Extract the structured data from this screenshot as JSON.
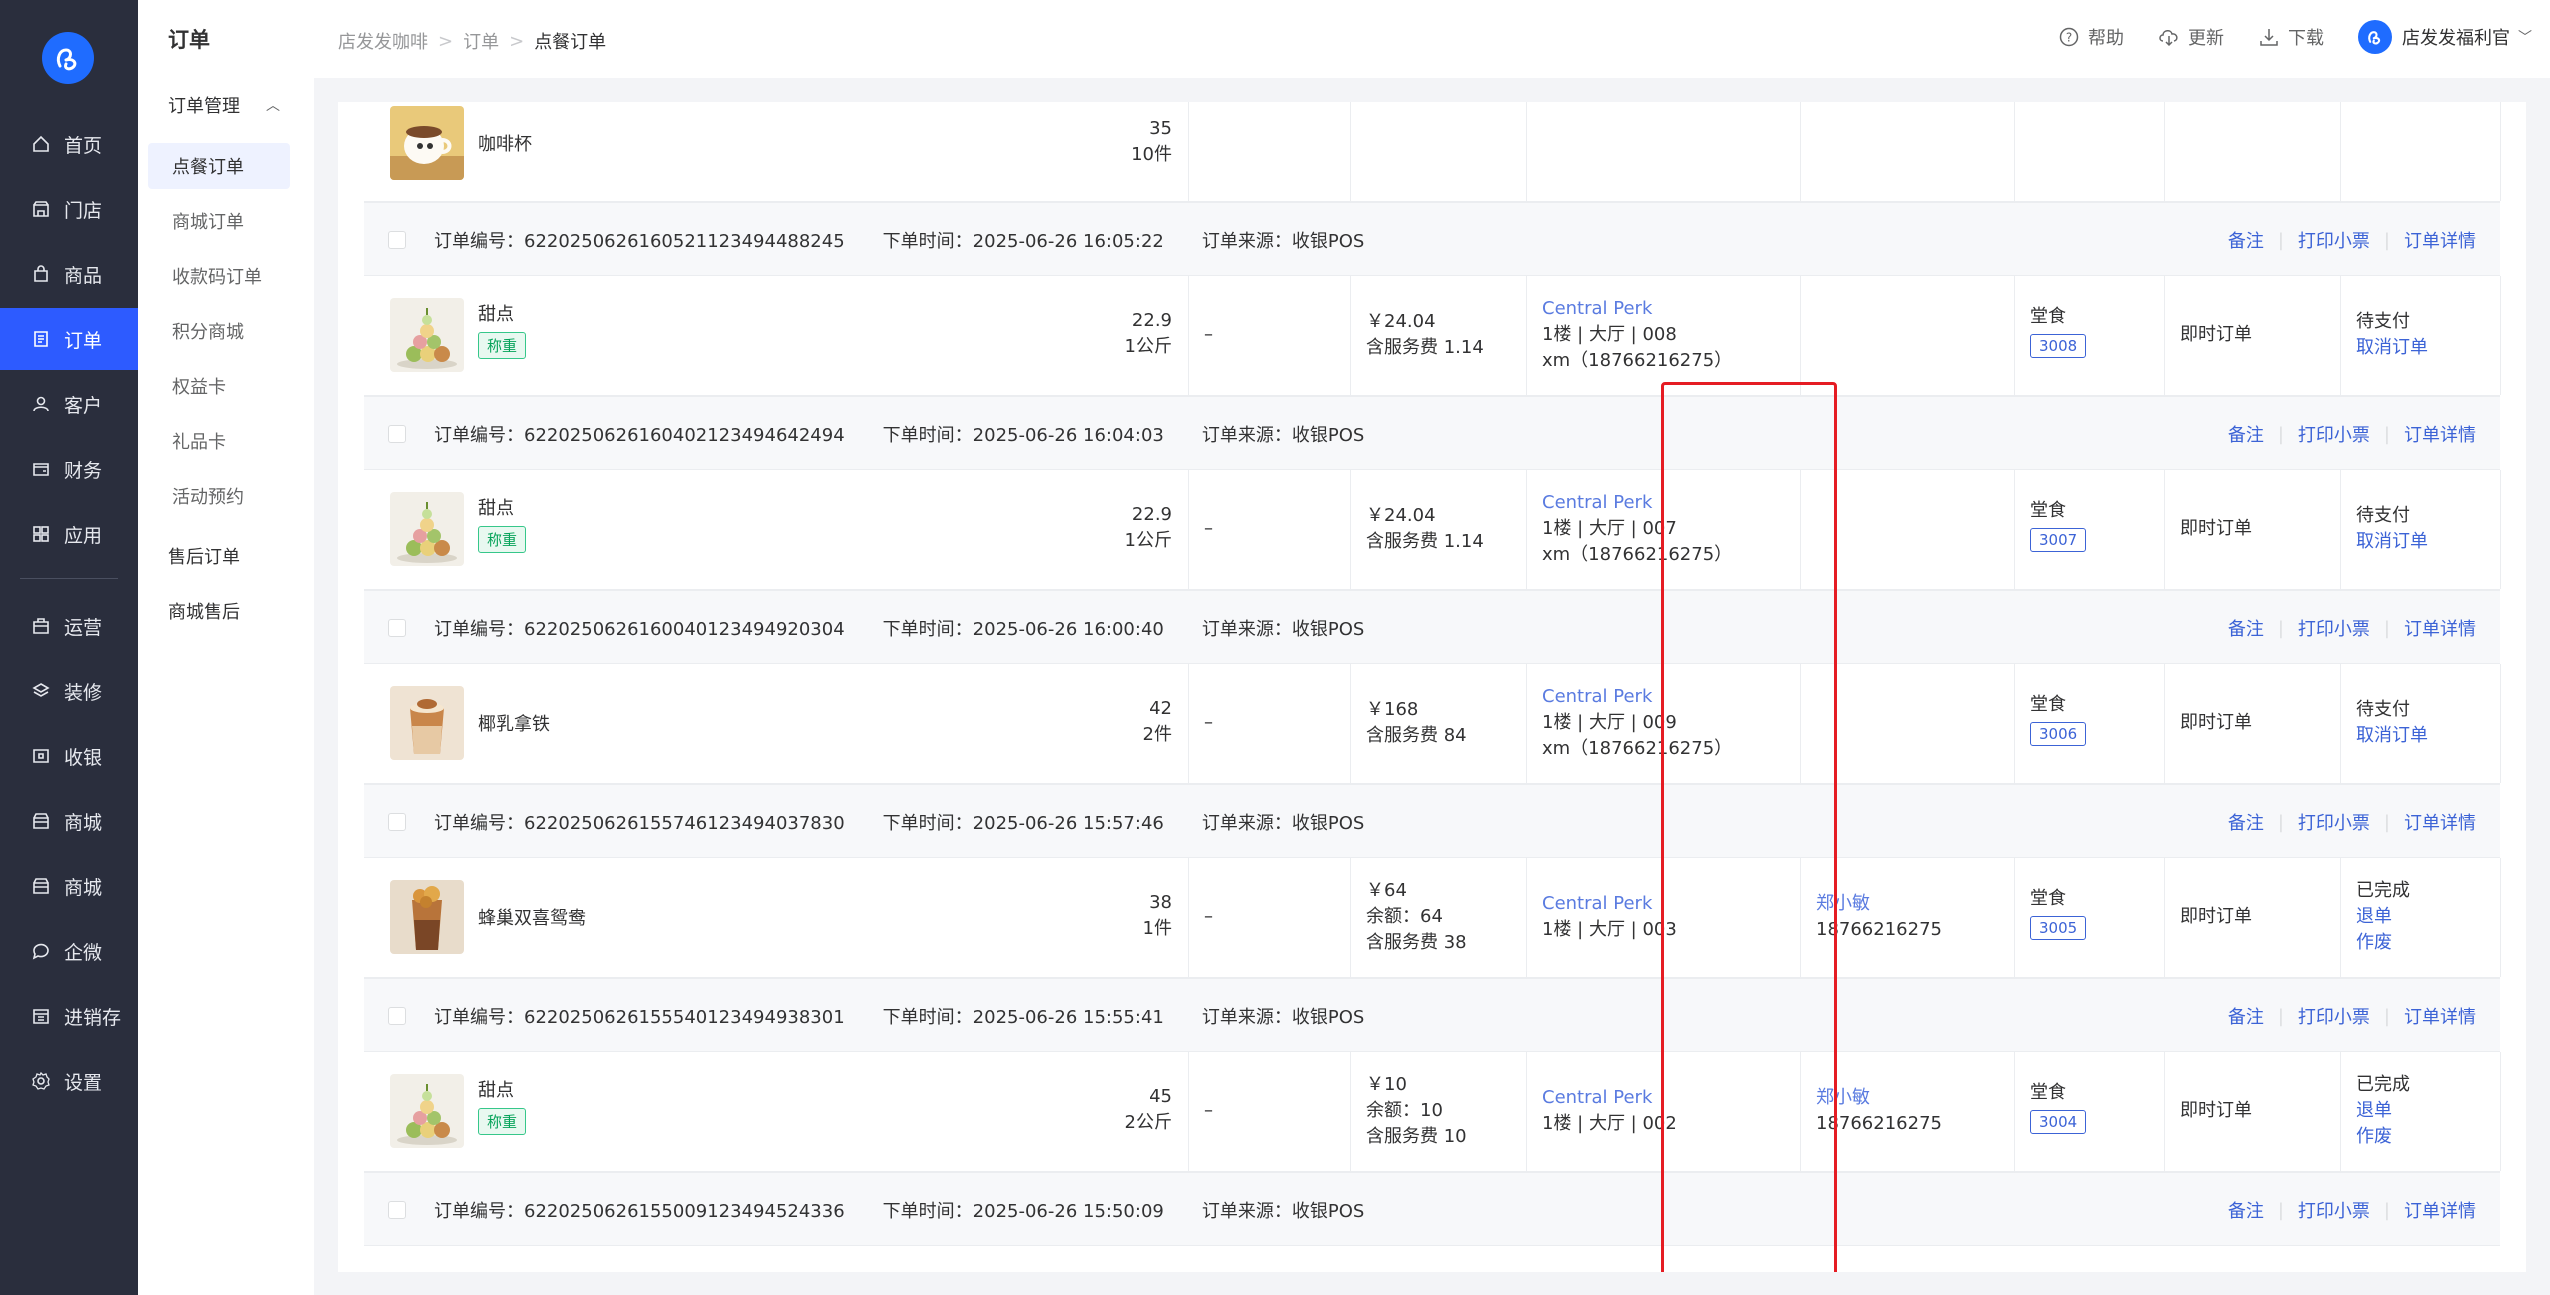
{
  "nav": {
    "items": [
      {
        "label": "首页",
        "icon": "home-icon"
      },
      {
        "label": "门店",
        "icon": "store-icon"
      },
      {
        "label": "商品",
        "icon": "bag-icon"
      },
      {
        "label": "订单",
        "icon": "order-icon",
        "active": true
      },
      {
        "label": "客户",
        "icon": "user-icon"
      },
      {
        "label": "财务",
        "icon": "wallet-icon"
      },
      {
        "label": "应用",
        "icon": "apps-icon"
      },
      {
        "label": "运营",
        "icon": "operation-icon"
      },
      {
        "label": "装修",
        "icon": "layers-icon"
      },
      {
        "label": "收银",
        "icon": "cashier-icon"
      },
      {
        "label": "商城",
        "icon": "shop-icon"
      },
      {
        "label": "商城",
        "icon": "shop-icon"
      },
      {
        "label": "企微",
        "icon": "chat-icon"
      },
      {
        "label": "进销存",
        "icon": "inventory-icon"
      },
      {
        "label": "设置",
        "icon": "settings-icon"
      }
    ]
  },
  "subnav": {
    "title": "订单",
    "group": "订单管理",
    "items": [
      "点餐订单",
      "商城订单",
      "收款码订单",
      "积分商城",
      "权益卡",
      "礼品卡",
      "活动预约"
    ],
    "extra": [
      "售后订单",
      "商城售后"
    ]
  },
  "header": {
    "breadcrumb": [
      "店发发咖啡",
      "订单",
      "点餐订单"
    ],
    "help": "帮助",
    "update": "更新",
    "download": "下载",
    "user": "店发发福利官"
  },
  "orders": {
    "top_product": {
      "name": "咖啡杯",
      "price": "35",
      "qty": "10件"
    },
    "ops": {
      "note": "备注",
      "print": "打印小票",
      "detail": "订单详情"
    },
    "labels": {
      "no": "订单编号：",
      "time": "下单时间：",
      "source": "订单来源："
    },
    "list": [
      {
        "no": "622025062616052112349448824 5",
        "no_full": "6220250626160521123494488245",
        "time": "2025-06-26 16:05:22",
        "source": "收银POS",
        "product": "甜点",
        "tag": "称重",
        "price": "22.9",
        "qty": "1公斤",
        "discount": "–",
        "amount": [
          "￥24.04",
          "含服务费 1.14"
        ],
        "store": "Central Perk",
        "store_info": "1楼 | 大厅 |  008",
        "customer_line": "xm（18766216275）",
        "buyer_name": "",
        "buyer_phone": "",
        "dine": "堂食",
        "pickup": "3008",
        "type": "即时订单",
        "status": "待支付",
        "actions": [
          "取消订单"
        ]
      },
      {
        "no_full": "6220250626160402123494642494",
        "time": "2025-06-26 16:04:03",
        "source": "收银POS",
        "product": "甜点",
        "tag": "称重",
        "price": "22.9",
        "qty": "1公斤",
        "discount": "–",
        "amount": [
          "￥24.04",
          "含服务费 1.14"
        ],
        "store": "Central Perk",
        "store_info": "1楼 | 大厅 |  007",
        "customer_line": "xm（18766216275）",
        "buyer_name": "",
        "buyer_phone": "",
        "dine": "堂食",
        "pickup": "3007",
        "type": "即时订单",
        "status": "待支付",
        "actions": [
          "取消订单"
        ]
      },
      {
        "no_full": "6220250626160040123494920304",
        "time": "2025-06-26 16:00:40",
        "source": "收银POS",
        "product": "椰乳拿铁",
        "tag": "",
        "price": "42",
        "qty": "2件",
        "discount": "–",
        "amount": [
          "￥168",
          "含服务费 84"
        ],
        "store": "Central Perk",
        "store_info": "1楼 | 大厅 |  009",
        "customer_line": "xm（18766216275）",
        "buyer_name": "",
        "buyer_phone": "",
        "dine": "堂食",
        "pickup": "3006",
        "type": "即时订单",
        "status": "待支付",
        "actions": [
          "取消订单"
        ]
      },
      {
        "no_full": "6220250626155746123494037830",
        "time": "2025-06-26 15:57:46",
        "source": "收银POS",
        "product": "蜂巢双喜鸳鸯",
        "tag": "",
        "price": "38",
        "qty": "1件",
        "discount": "–",
        "amount": [
          "￥64",
          "余额：64",
          "含服务费 38"
        ],
        "store": "Central Perk",
        "store_info": "1楼 | 大厅 |  003",
        "customer_line": "",
        "buyer_name": "郑小敏",
        "buyer_phone": "18766216275",
        "dine": "堂食",
        "pickup": "3005",
        "type": "即时订单",
        "status": "已完成",
        "actions": [
          "退单",
          "作废"
        ]
      },
      {
        "no_full": "6220250626155540123494938301",
        "time": "2025-06-26 15:55:41",
        "source": "收银POS",
        "product": "甜点",
        "tag": "称重",
        "price": "45",
        "qty": "2公斤",
        "discount": "–",
        "amount": [
          "￥10",
          "余额：10",
          "含服务费 10"
        ],
        "store": "Central Perk",
        "store_info": "1楼 | 大厅 |  002",
        "customer_line": "",
        "buyer_name": "郑小敏",
        "buyer_phone": "18766216275",
        "dine": "堂食",
        "pickup": "3004",
        "type": "即时订单",
        "status": "已完成",
        "actions": [
          "退单",
          "作废"
        ]
      }
    ],
    "last_head": {
      "no_full": "6220250626155009123494524336",
      "time": "2025-06-26 15:50:09",
      "source": "收银POS"
    }
  },
  "colors": {
    "accent": "#2d5bff",
    "link": "#3c63d6",
    "highlight": "#e51c23",
    "nav_bg": "#2a2e3d"
  }
}
